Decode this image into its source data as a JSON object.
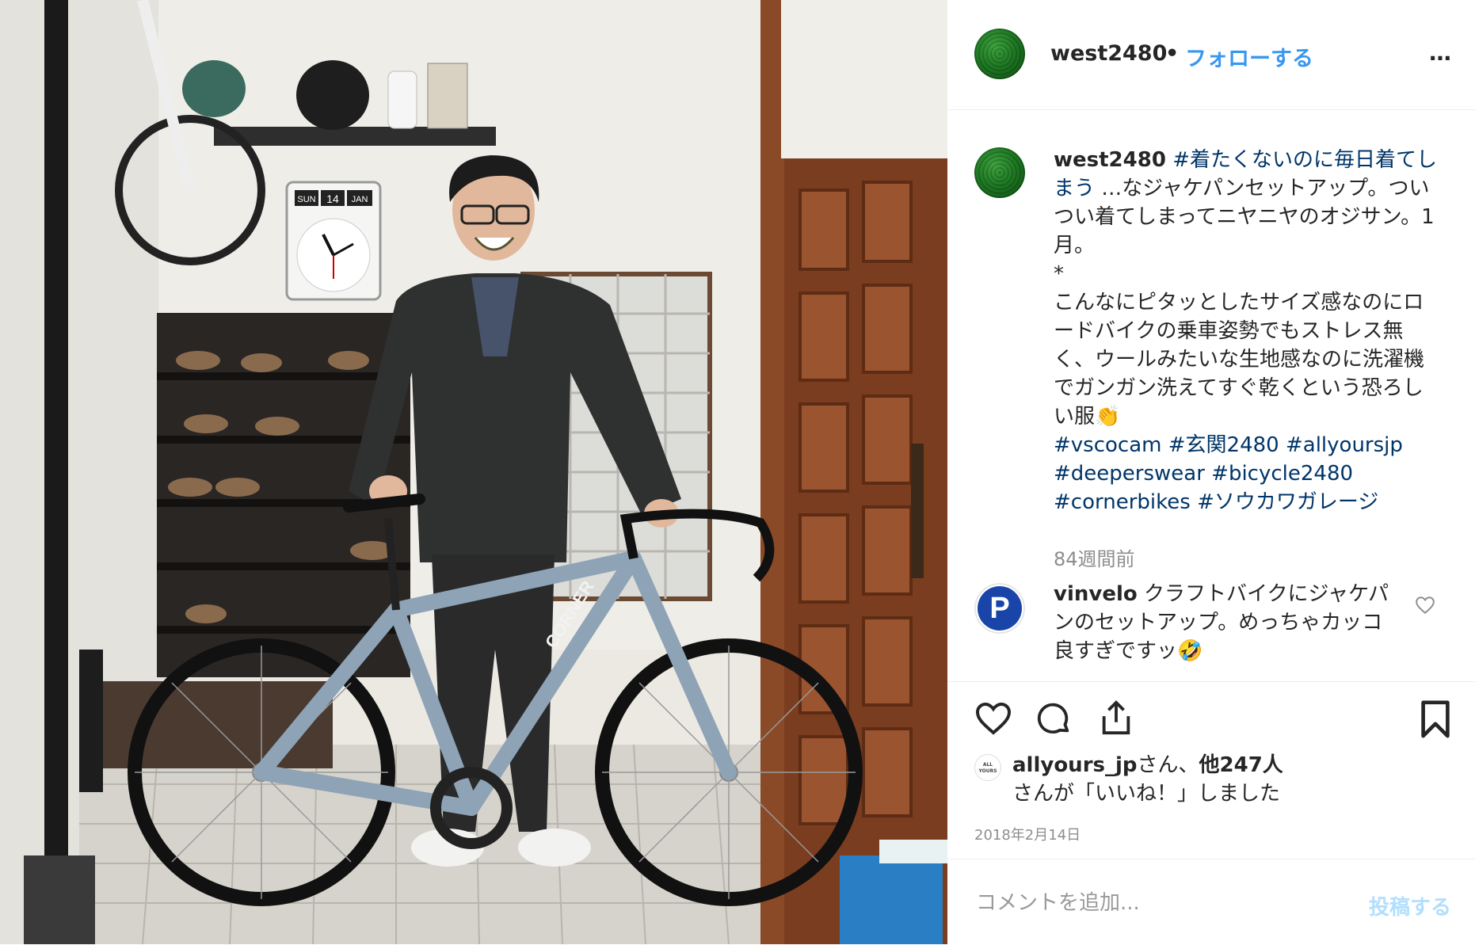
{
  "post": {
    "username": "west2480",
    "separator": "•",
    "follow_label": "フォローする",
    "more_icon": "…"
  },
  "caption": {
    "username": "west2480",
    "tag1": "#着たくないのに毎日着てしまう",
    "text1": " …なジャケパンセットアップ。ついつい着てしまってニヤニヤのオジサン。1月。",
    "star": "*",
    "text2": "こんなにピタッとしたサイズ感なのにロードバイクの乗車姿勢でもストレス無く、ウールみたいな生地感なのに洗濯機でガンガン洗えてすぐ乾くという恐ろしい服👏",
    "hashtags": [
      "#vscocam",
      "#玄関2480",
      "#allyoursjp",
      "#deeperswear",
      "#bicycle2480",
      "#cornerbikes",
      "#ソウカワガレージ"
    ],
    "time": "84週間前"
  },
  "comment": {
    "avatar_letter": "P",
    "username": "vinvelo",
    "text": " クラフトバイクにジャケパンのセットアップ。めっちゃカッコ良すぎですッ🤣"
  },
  "likes": {
    "avatar_text": "ALL YOURS",
    "first_user": "allyours_jp",
    "suffix1": "さん、",
    "others": "他247人",
    "suffix2": "さんが「いいね！」しました"
  },
  "date": "2018年2月14日",
  "comment_box": {
    "placeholder": "コメントを追加...",
    "post_label": "投稿する"
  },
  "photo": {
    "clock_day": "SUN",
    "clock_date": "14",
    "clock_month": "JAN",
    "frame_brand": "CORNER"
  },
  "colors": {
    "link_blue": "#3897f0",
    "hashtag": "#003569",
    "muted": "#8e8e8e",
    "post_disabled": "#b2dffc"
  }
}
